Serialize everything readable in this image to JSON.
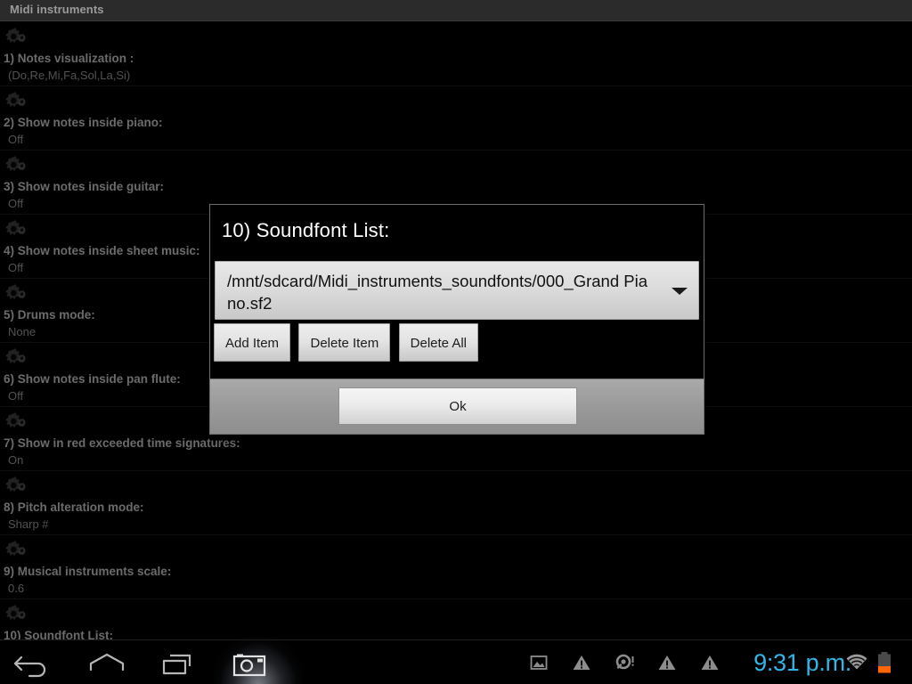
{
  "window": {
    "title": "Midi instruments"
  },
  "settings": {
    "items": [
      {
        "icon": "gears-icon",
        "title": "1) Notes visualization :",
        "summary": "(Do,Re,Mi,Fa,Sol,La,Si)"
      },
      {
        "icon": "gears-icon",
        "title": "2) Show notes inside piano:",
        "summary": "Off"
      },
      {
        "icon": "gears-icon",
        "title": "3) Show notes inside guitar:",
        "summary": "Off"
      },
      {
        "icon": "gears-icon",
        "title": "4) Show notes inside sheet music:",
        "summary": "Off"
      },
      {
        "icon": "gears-icon",
        "title": "5) Drums mode:",
        "summary": "None"
      },
      {
        "icon": "gears-icon",
        "title": "6) Show notes inside pan flute:",
        "summary": "Off"
      },
      {
        "icon": "gears-icon",
        "title": "7) Show in red exceeded time signatures:",
        "summary": "On"
      },
      {
        "icon": "gears-icon",
        "title": "8) Pitch alteration mode:",
        "summary": "Sharp  #"
      },
      {
        "icon": "gears-icon",
        "title": "9) Musical instruments scale:",
        "summary": "0.6"
      },
      {
        "icon": "gears-icon",
        "title": "10) Soundfont List:",
        "summary": ""
      }
    ]
  },
  "dialog": {
    "title": "10) Soundfont List:",
    "spinner": {
      "value": "/mnt/sdcard/Midi_instruments_soundfonts/000_Grand Piano.sf2",
      "arrow_icon": "chevron-down-icon"
    },
    "buttons": [
      {
        "label": "Add Item",
        "name": "add-item-button"
      },
      {
        "label": "Delete Item",
        "name": "delete-item-button"
      },
      {
        "label": "Delete All",
        "name": "delete-all-button"
      }
    ],
    "ok_label": "Ok"
  },
  "navbar": {
    "back_icon": "back-arrow-icon",
    "home_icon": "home-icon",
    "recents_icon": "recent-apps-icon",
    "screenshot_icon": "camera-icon"
  },
  "statusbar": {
    "icons": [
      "screenshot-image-icon",
      "warning-triangle-icon",
      "alert-circle-icon",
      "warning-triangle-icon",
      "warning-triangle-icon"
    ],
    "clock": "9:31 p.m.",
    "wifi_icon": "wifi-icon",
    "battery_icon": "battery-icon"
  },
  "colors": {
    "accent_blue": "#33b5e5",
    "battery_fill": "#ff6600",
    "screen_background": "#000000",
    "title_bar": "#2b2b2b"
  }
}
